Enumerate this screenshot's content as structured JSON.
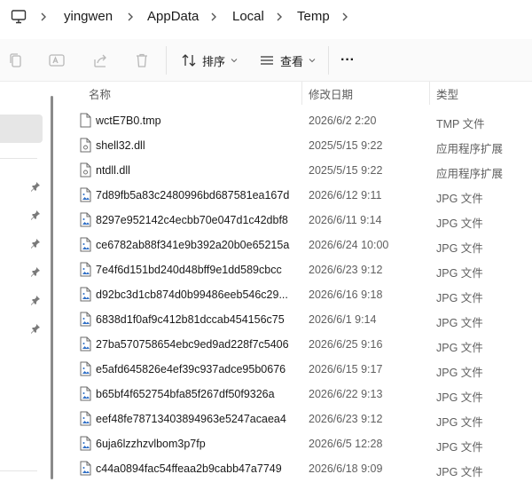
{
  "breadcrumb": {
    "items": [
      "yingwen",
      "AppData",
      "Local",
      "Temp"
    ]
  },
  "toolbar": {
    "sort_label": "排序",
    "view_label": "查看",
    "more_label": "···"
  },
  "columns": {
    "name": "名称",
    "modified": "修改日期",
    "type": "类型"
  },
  "files": [
    {
      "name": "wctE7B0.tmp",
      "modified": "2026/6/2 2:20",
      "type": "TMP 文件",
      "icon": "generic-file-icon"
    },
    {
      "name": "shell32.dll",
      "modified": "2025/5/15 9:22",
      "type": "应用程序扩展",
      "icon": "dll-file-icon"
    },
    {
      "name": "ntdll.dll",
      "modified": "2025/5/15 9:22",
      "type": "应用程序扩展",
      "icon": "dll-file-icon"
    },
    {
      "name": "7d89fb5a83c2480996bd687581ea167d",
      "modified": "2026/6/12 9:11",
      "type": "JPG 文件",
      "icon": "image-file-icon"
    },
    {
      "name": "8297e952142c4ecbb70e047d1c42dbf8",
      "modified": "2026/6/11 9:14",
      "type": "JPG 文件",
      "icon": "image-file-icon"
    },
    {
      "name": "ce6782ab88f341e9b392a20b0e65215a",
      "modified": "2026/6/24 10:00",
      "type": "JPG 文件",
      "icon": "image-file-icon"
    },
    {
      "name": "7e4f6d151bd240d48bff9e1dd589cbcc",
      "modified": "2026/6/23 9:12",
      "type": "JPG 文件",
      "icon": "image-file-icon"
    },
    {
      "name": "d92bc3d1cb874d0b99486eeb546c29...",
      "modified": "2026/6/16 9:18",
      "type": "JPG 文件",
      "icon": "image-file-icon"
    },
    {
      "name": "6838d1f0af9c412b81dccab454156c75",
      "modified": "2026/6/1 9:14",
      "type": "JPG 文件",
      "icon": "image-file-icon"
    },
    {
      "name": "27ba570758654ebc9ed9ad228f7c5406",
      "modified": "2026/6/25 9:16",
      "type": "JPG 文件",
      "icon": "image-file-icon"
    },
    {
      "name": "e5afd645826e4ef39c937adce95b0676",
      "modified": "2026/6/15 9:17",
      "type": "JPG 文件",
      "icon": "image-file-icon"
    },
    {
      "name": "b65bf4f652754bfa85f267df50f9326a",
      "modified": "2026/6/22 9:13",
      "type": "JPG 文件",
      "icon": "image-file-icon"
    },
    {
      "name": "eef48fe78713403894963e5247acaea4",
      "modified": "2026/6/23 9:12",
      "type": "JPG 文件",
      "icon": "image-file-icon"
    },
    {
      "name": "6uja6lzzhzvlbom3p7fp",
      "modified": "2026/6/5 12:28",
      "type": "JPG 文件",
      "icon": "image-file-icon"
    },
    {
      "name": "c44a0894fac54ffeaa2b9cabb47a7749",
      "modified": "2026/6/18 9:09",
      "type": "JPG 文件",
      "icon": "image-file-icon"
    }
  ],
  "colors": {
    "accent": "#2f6fc6",
    "selected_nav": "#e6e6e6",
    "disabled_icon": "#b8b8b8"
  }
}
